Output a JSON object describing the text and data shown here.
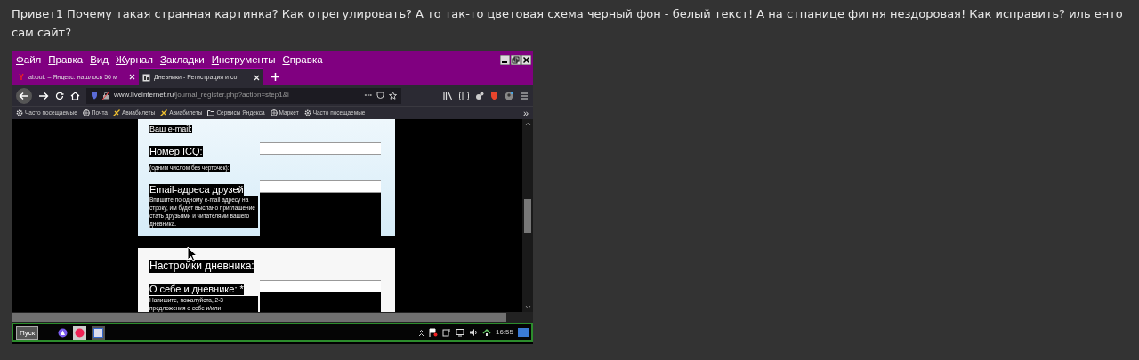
{
  "post": {
    "text": "Привет1 Почему такая странная картинка? Как отрегулировать? А то так-то цветовая схема черный фон - белый текст! А на стпанице фигня нездоровая! Как исправить? иль енто сам сайт?"
  },
  "screenshot": {
    "menu": [
      "Файл",
      "Правка",
      "Вид",
      "Журнал",
      "Закладки",
      "Инструменты",
      "Справка"
    ],
    "tabs": [
      {
        "label": "about: – Яндекс: нашлось 56 м",
        "selected": false,
        "kind": "yandex"
      },
      {
        "label": "Дневники - Регистрация и со",
        "selected": true,
        "kind": "diary"
      }
    ],
    "address": {
      "host": "www.liveinternet.ru",
      "path": "/journal_register.php?action=step1&i",
      "more": "•••"
    },
    "bookmarks": [
      {
        "label": "Часто посещаемые",
        "kind": "gear"
      },
      {
        "label": "Почта",
        "kind": "globe"
      },
      {
        "label": "Авиабилеты",
        "kind": "plane"
      },
      {
        "label": "Авиабилеты",
        "kind": "plane"
      },
      {
        "label": "Сервисы Яндекса",
        "kind": "folder"
      },
      {
        "label": "Маркет",
        "kind": "globe"
      },
      {
        "label": "Часто посещаемые",
        "kind": "gear"
      }
    ],
    "bookmarks_more": "»",
    "sections": [
      {
        "kind": "tinted",
        "top_label": "Ваш e-mail:",
        "fields": [
          {
            "label": "Номер ICQ:",
            "hint": "(одним числом без черточек):",
            "kind": "input"
          },
          {
            "label": "Email-адреса друзей",
            "hint": "Впишите по одному e-mail адресу на строку, им будет выслано приглашение стать друзьями и читателями вашего дневника.",
            "kind": "textarea"
          }
        ]
      },
      {
        "kind": "plain",
        "heading": "Настройки дневника:",
        "fields": [
          {
            "label": "О себе и дневнике: *",
            "hint": "Напишите, пожалуйста, 2-3 предложения о себе и/или",
            "kind": "textarea"
          }
        ]
      }
    ],
    "taskbar": {
      "start": "Пуск",
      "clock": "16:55"
    }
  }
}
